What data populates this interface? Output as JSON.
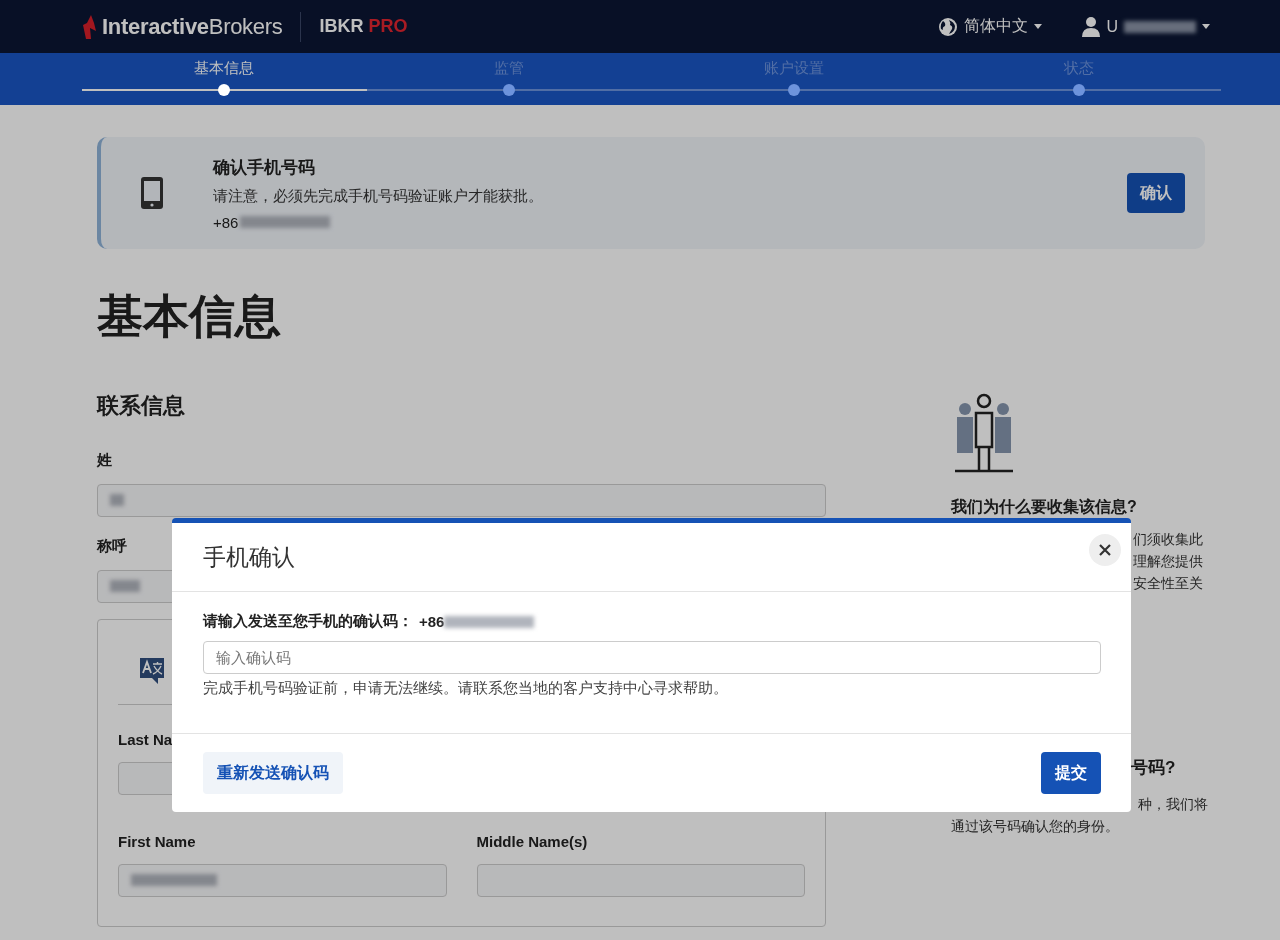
{
  "header": {
    "brand_bold": "Interactive",
    "brand_light": "Brokers",
    "product": "IBKR",
    "product_tier": "PRO",
    "language": "简体中文",
    "user": "U"
  },
  "steps": [
    {
      "label": "基本信息",
      "selected": true
    },
    {
      "label": "监管",
      "selected": false
    },
    {
      "label": "账户设置",
      "selected": false
    },
    {
      "label": "状态",
      "selected": false
    }
  ],
  "progress": {
    "level": 0.25
  },
  "alert": {
    "title": "确认手机号码",
    "text": "请注意，必须先完成手机号码验证账户才能获批。",
    "phone": "+86",
    "button": "确认"
  },
  "page_title": "基本信息",
  "contact": {
    "title": "联系信息",
    "surname_label": "姓",
    "salutation_label": "称呼",
    "last_name_label": "Last Na",
    "first_name_label": "First Name",
    "middle_name_label": "Middle Name(s)"
  },
  "aside": {
    "heading": "我们为什么要收集该信息?",
    "lines": [
      "们须收集此",
      "理解您提供",
      "安全性至关"
    ],
    "heading_2": "号码?",
    "lines_2": [
      "种，我们将"
    ],
    "text_2": "通过该号码确认您的身份。"
  },
  "modal": {
    "title": "手机确认",
    "code_label": "请输入发送至您手机的确认码：",
    "phone": "+86",
    "placeholder": "输入确认码",
    "help": "完成手机号码验证前，申请无法继续。请联系您当地的客户支持中心寻求帮助。",
    "resend_button": "重新发送确认码",
    "submit_button": "提交"
  }
}
